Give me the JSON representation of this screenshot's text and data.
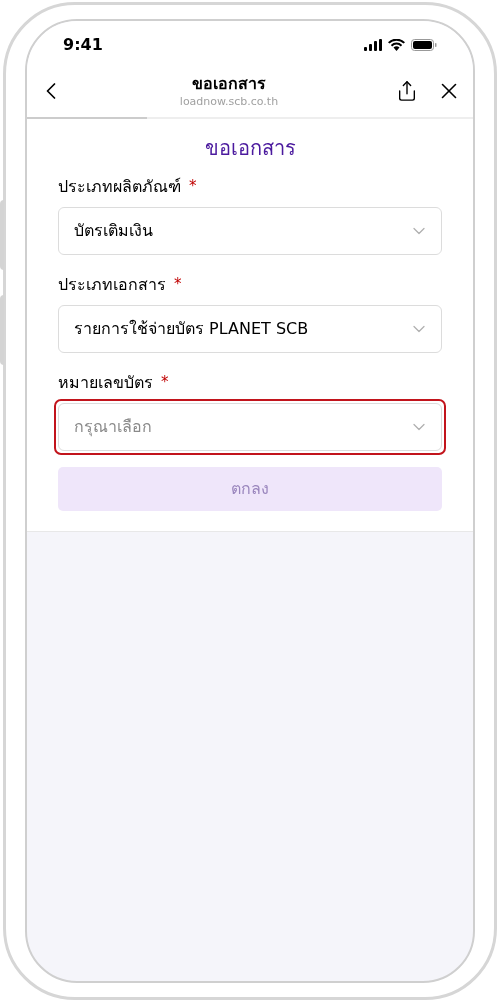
{
  "status_bar": {
    "time": "9:41"
  },
  "nav": {
    "title": "ขอเอกสาร",
    "url": "loadnow.scb.co.th",
    "progress": {
      "level": 0.27
    }
  },
  "heading": "ขอเอกสาร",
  "fields": [
    {
      "label": "ประเภทผลิตภัณฑ์",
      "required_mark": "*",
      "value": "บัตรเติมเงิน",
      "highlighted": false
    },
    {
      "label": "ประเภทเอกสาร",
      "required_mark": "*",
      "value": "รายการใช้จ่ายบัตร PLANET SCB",
      "highlighted": false
    },
    {
      "label": "หมายเลขบัตร",
      "required_mark": "*",
      "placeholder": "กรุณาเลือก",
      "highlighted": true
    }
  ],
  "submit": {
    "label": "ตกลง",
    "disabled": true
  }
}
